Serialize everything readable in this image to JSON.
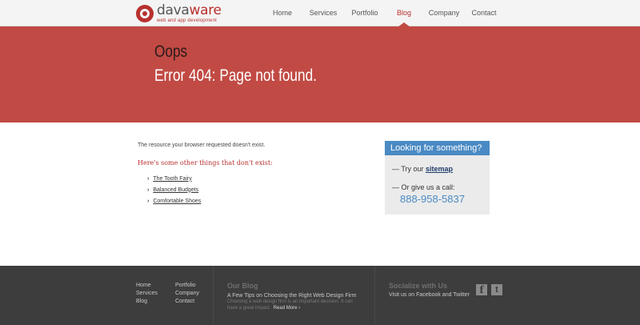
{
  "logo": {
    "name_part1": "dava",
    "name_part2": "ware",
    "tagline": "web and app development"
  },
  "nav": [
    {
      "label": "Home"
    },
    {
      "label": "Services"
    },
    {
      "label": "Portfolio"
    },
    {
      "label": "Blog",
      "active": true
    },
    {
      "label": "Company"
    },
    {
      "label": "Contact"
    }
  ],
  "hero": {
    "title": "Oops",
    "subtitle": "Error 404: Page not found."
  },
  "content": {
    "message": "The resource your browser requested doesn't exist.",
    "heading": "Here's some other things that don't exist:",
    "items": [
      "The Tooth Fairy",
      "Balanced Budgets",
      "Comfortable Shoes"
    ]
  },
  "sidebox": {
    "title": "Looking for something?",
    "try_prefix": "— Try our ",
    "sitemap": "sitemap",
    "call_text": "— Or give us a call:",
    "phone": "888-958-5837"
  },
  "footer": {
    "col1": [
      "Home",
      "Services",
      "Blog"
    ],
    "col2": [
      "Portfolio",
      "Company",
      "Contact"
    ],
    "blog_title": "Our Blog",
    "blog_post": "A Few Tips on Choosing the Right Web Design Firm",
    "blog_excerpt": "Choosing a web design firm is an important decision.  It can have a great impact.",
    "read_more": "Read More ›",
    "social_title": "Socialize with Us",
    "social_sub": "Visit us on Facebook and Twitter",
    "fb_glyph": "f",
    "tw_glyph": "t"
  },
  "colors": {
    "accent": "#b8312f",
    "hero_bg": "#c14a44",
    "box_blue": "#4a8ac4",
    "footer_bg": "#3d3d3d"
  }
}
